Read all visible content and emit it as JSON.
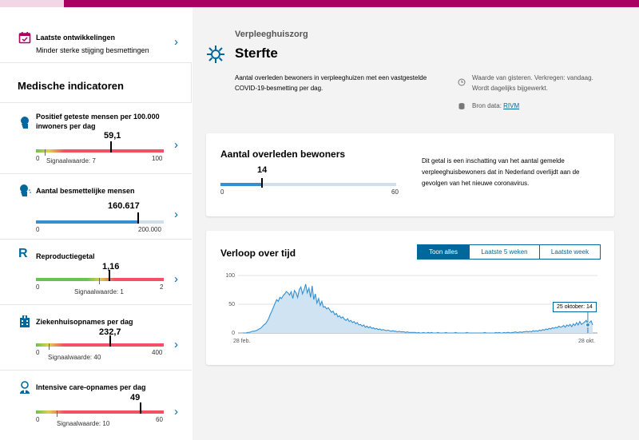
{
  "sidebar": {
    "latest": {
      "title": "Laatste ontwikkelingen",
      "subtitle": "Minder sterke stijging besmettingen"
    },
    "heading": "Medische indicatoren",
    "indicators": [
      {
        "title_line1": "Positief geteste mensen per 100.000",
        "title_line2": "inwoners per dag",
        "value": "59,1",
        "min": "0",
        "max": "100",
        "signal": "Signaalwaarde: 7",
        "fraction": 0.591
      },
      {
        "title_line1": "Aantal besmettelijke mensen",
        "title_line2": "",
        "value": "160.617",
        "min": "0",
        "max": "200.000",
        "signal": "",
        "fraction": 0.803
      },
      {
        "title_line1": "Reproductiegetal",
        "title_line2": "",
        "value": "1,16",
        "min": "0",
        "max": "2",
        "signal": "Signaalwaarde: 1",
        "fraction": 0.58
      },
      {
        "title_line1": "Ziekenhuisopnames per dag",
        "title_line2": "",
        "value": "232,7",
        "min": "0",
        "max": "400",
        "signal": "Signaalwaarde: 40",
        "fraction": 0.582
      },
      {
        "title_line1": "Intensive care-opnames per dag",
        "title_line2": "",
        "value": "49",
        "min": "0",
        "max": "60",
        "signal": "Signaalwaarde: 10",
        "fraction": 0.817
      }
    ],
    "icons": [
      "calendar-check-icon",
      "person-head-icon",
      "person-sneeze-icon",
      "r-letter-icon",
      "hospital-icon",
      "doctor-icon"
    ]
  },
  "header": {
    "category": "Verpleeghuiszorg",
    "title": "Sterfte",
    "description": "Aantal overleden bewoners in verpleeghuizen met een vastgestelde COVID-19-besmetting per dag.",
    "meta_line1": "Waarde van gisteren. Verkregen: vandaag.",
    "meta_line2": "Wordt dagelijks bijgewerkt.",
    "source_label": "Bron data:",
    "source_link": "RIVM"
  },
  "kpi_card": {
    "title": "Aantal overleden bewoners",
    "value": "14",
    "min": "0",
    "max": "60",
    "fraction": 0.233,
    "description": "Dit getal is een inschatting van het aantal gemelde verpleeghuisbewoners dat in Nederland overlijdt aan de gevolgen van het nieuwe coronavirus."
  },
  "chart_card": {
    "title": "Verloop over tijd",
    "tabs": [
      "Toon alles",
      "Laatste 5 weken",
      "Laatste week"
    ],
    "active_tab": 0,
    "tooltip": "25 oktober: 14"
  },
  "colors": {
    "brand": "#01689b",
    "topbar": "#a90061",
    "line": "#3490d1",
    "area": "#cfe3f3",
    "bad": "#f35065",
    "good": "#69c253"
  },
  "chart_data": {
    "type": "area",
    "title": "",
    "xlabel": "",
    "ylabel": "",
    "x_start": "28 feb.",
    "x_end": "28 okt.",
    "ylim": [
      0,
      100
    ],
    "yticks": [
      "100",
      "50",
      "0"
    ],
    "series": [
      {
        "values": [
          0,
          0,
          0,
          1,
          1,
          2,
          3,
          3,
          4,
          5,
          7,
          8,
          11,
          14,
          16,
          20,
          25,
          32,
          38,
          45,
          52,
          58,
          55,
          62,
          60,
          65,
          68,
          72,
          70,
          66,
          72,
          60,
          74,
          70,
          62,
          75,
          80,
          68,
          75,
          85,
          70,
          78,
          62,
          82,
          58,
          68,
          52,
          60,
          48,
          55,
          45,
          46,
          42,
          44,
          40,
          36,
          38,
          32,
          34,
          28,
          30,
          26,
          28,
          24,
          22,
          25,
          20,
          22,
          18,
          20,
          16,
          18,
          14,
          15,
          12,
          14,
          10,
          12,
          9,
          11,
          8,
          9,
          7,
          8,
          6,
          7,
          5,
          6,
          5,
          4,
          5,
          4,
          3,
          4,
          3,
          3,
          2,
          3,
          2,
          2,
          2,
          1,
          2,
          1,
          1,
          1,
          1,
          1,
          0,
          1,
          0,
          0,
          1,
          0,
          0,
          1,
          0,
          1,
          0,
          0,
          0,
          1,
          0,
          0,
          0,
          0,
          1,
          0,
          0,
          0,
          0,
          0,
          1,
          0,
          0,
          0,
          0,
          0,
          0,
          1,
          0,
          0,
          0,
          0,
          0,
          0,
          0,
          0,
          0,
          0,
          1,
          0,
          0,
          0,
          0,
          0,
          0,
          1,
          0,
          1,
          0,
          0,
          1,
          0,
          1,
          1,
          0,
          1,
          1,
          2,
          1,
          1,
          2,
          1,
          2,
          2,
          3,
          2,
          3,
          2,
          4,
          3,
          4,
          3,
          5,
          4,
          6,
          5,
          7,
          6,
          8,
          7,
          9,
          8,
          10,
          9,
          12,
          10,
          11,
          13,
          10,
          14,
          12,
          15,
          11,
          16,
          13,
          18,
          14,
          20,
          15,
          17,
          19,
          22,
          16,
          18,
          21,
          14
        ]
      }
    ],
    "highlight": {
      "label": "25 oktober",
      "value": 14
    }
  }
}
